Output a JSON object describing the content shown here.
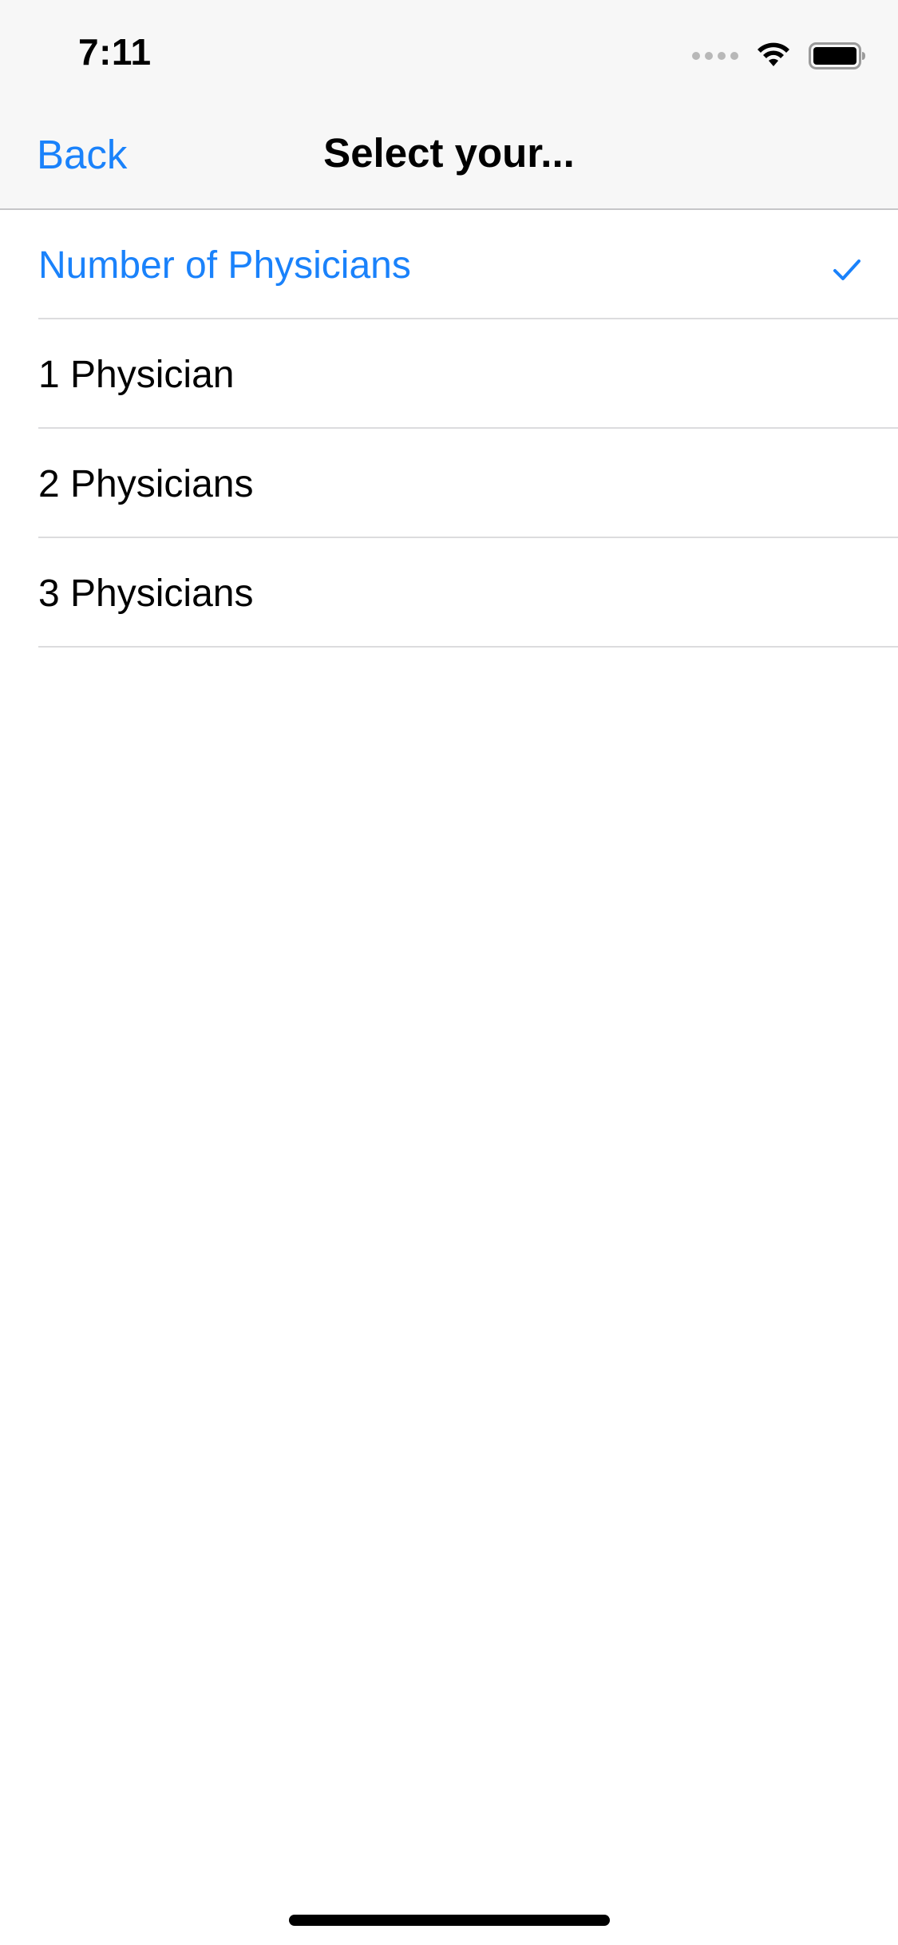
{
  "status_bar": {
    "time": "7:11",
    "icons": [
      "signal-icon",
      "wifi-icon",
      "battery-icon"
    ]
  },
  "nav": {
    "back_label": "Back",
    "title": "Select your..."
  },
  "list": {
    "items": [
      {
        "label": "Number of Physicians",
        "selected": true
      },
      {
        "label": "1 Physician",
        "selected": false
      },
      {
        "label": "2 Physicians",
        "selected": false
      },
      {
        "label": "3 Physicians",
        "selected": false
      }
    ]
  },
  "colors": {
    "accent": "#1a82fb",
    "nav_background": "#f7f7f7",
    "separator": "#dcdcde"
  }
}
